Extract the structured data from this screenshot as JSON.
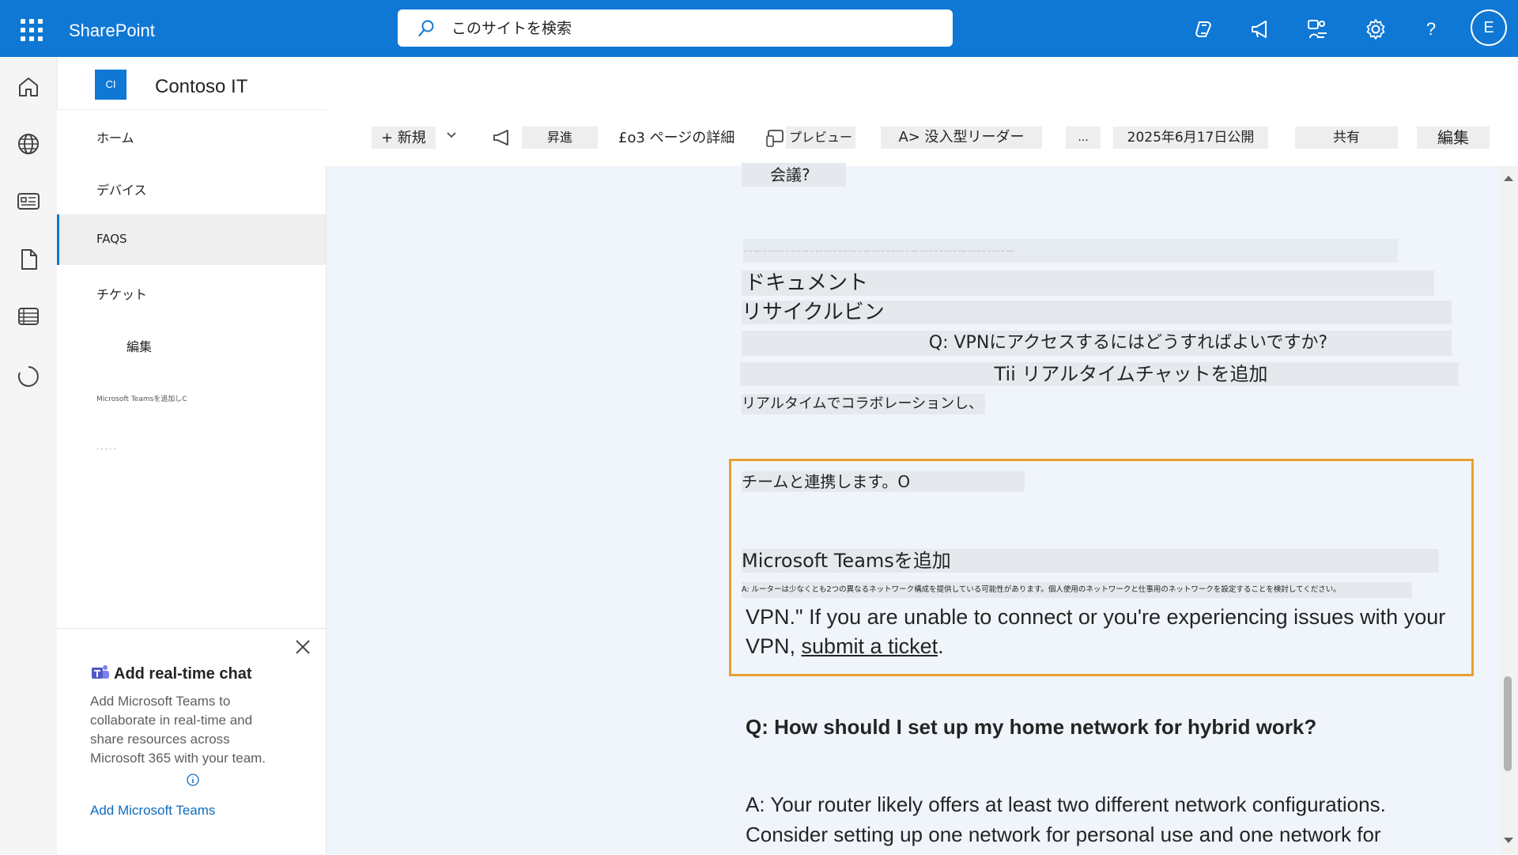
{
  "suite": {
    "brand": "SharePoint",
    "search_placeholder": "このサイトを検索",
    "help_label": "?",
    "avatar_initial": "E"
  },
  "site": {
    "logo_text": "CI",
    "title": "Contoso IT"
  },
  "nav": {
    "items": [
      {
        "label": "ホーム"
      },
      {
        "label": "デバイス"
      },
      {
        "label": "FAQS"
      },
      {
        "label": "チケット"
      },
      {
        "label": "編集"
      },
      {
        "label": "Microsoft Teamsを追加しC"
      },
      {
        "label": "- - - - -"
      }
    ]
  },
  "teams_card": {
    "title": "Add real-time chat",
    "body": "Add Microsoft Teams to collaborate in real-time and share resources across Microsoft 365 with your team.",
    "link": "Add Microsoft Teams"
  },
  "commands": {
    "new": "+ 新規",
    "promote": "昇進",
    "page_details": "£o3 ページの詳細",
    "preview": "プレビュー",
    "immersive": "A> 没入型リーダー",
    "more": "...",
    "published": "2025年6月17日公開",
    "share": "共有",
    "edit": "編集"
  },
  "content": {
    "meeting": "会議?",
    "faded_line": "‥ ‥ ‥‥ ‥ ‥‥ ‥‥ ‥ ‥ ‥ ‥‥ ‥ ‥‥ ‥‥ ‥ ‥ ‥ ‥‥ ‥ ‥‥ ‥‥ ‥ ‥ ‥ ‥‥ ‥ ‥‥ ‥‥ ‥ ‥ ‥ ‥‥ ‥ ‥‥ ‥‥ ‥ ‥ ‥ ‥‥ ‥ ‥‥",
    "documents": "ドキュメント",
    "recycle_bin": "リサイクルビン",
    "vpn_question_jp": "Q: VPNにアクセスするにはどうすればよいですか?",
    "add_chat_jp": "Tii リアルタイムチャットを追加",
    "collab_jp": "リアルタイムでコラボレーションし、",
    "team_jp": "チームと連携します。O",
    "add_teams_jp": "Microsoft Teamsを追加",
    "router_jp": "A: ルーターは少なくとも2つの異なるネットワーク構成を提供している可能性があります。個人使用のネットワークと仕事用のネットワークを設定することを検討してください。",
    "vpn_text_1": "VPN.\" If you are unable to connect or you're experiencing issues with your",
    "vpn_text_2_prefix": "VPN, ",
    "vpn_link": "submit a ticket",
    "vpn_text_2_suffix": ".",
    "home_network_q": "Q: How should I set up my home network for hybrid work?",
    "router_a_1": "A: Your router likely offers at least two different network configurations.",
    "router_a_2": "Consider setting up one network for personal use and one network for"
  }
}
